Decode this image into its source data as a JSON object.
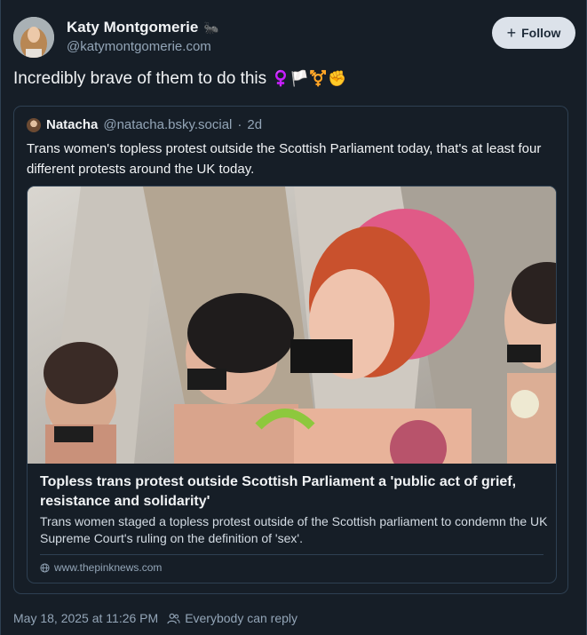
{
  "author": {
    "display_name": "Katy Montgomerie",
    "name_icon": "ant-icon",
    "handle": "@katymontgomerie.com"
  },
  "follow": {
    "label": "Follow",
    "icon": "plus-icon"
  },
  "post": {
    "text": "Incredibly brave of them to do this",
    "emojis": "♀️🏳️⚧️✊"
  },
  "quoted": {
    "author_name": "Natacha",
    "author_handle": "@natacha.bsky.social",
    "time_sep": "·",
    "age": "2d",
    "text": "Trans women's topless protest outside the Scottish Parliament today, that's at least four different protests around the UK today.",
    "link_card": {
      "title": "Topless trans protest outside Scottish Parliament a 'public act of grief, resistance and solidarity'",
      "description": "Trans women staged a topless protest outside of the Scottish parliament to condemn the UK Supreme Court's ruling on the definition of 'sex'.",
      "domain": "www.thepinknews.com"
    }
  },
  "footer": {
    "timestamp": "May 18, 2025 at 11:26 PM",
    "reply_setting": "Everybody can reply"
  }
}
